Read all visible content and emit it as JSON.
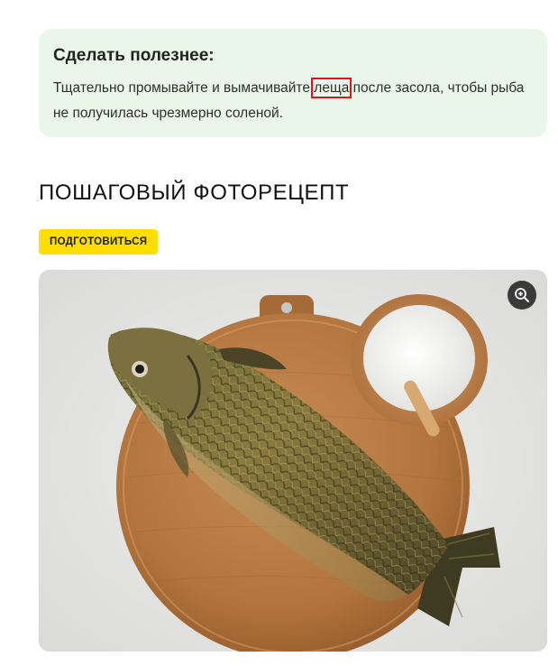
{
  "tip": {
    "title": "Сделать полезнее:",
    "text_before": "Тщательно промывайте и вымачивайте ",
    "highlighted_word": "леща",
    "text_after": " после засола, чтобы рыба не получилась чрезмерно соленой."
  },
  "section": {
    "title": "ПОШАГОВЫЙ ФОТОРЕЦЕПТ"
  },
  "prepare_button": {
    "label": "ПОДГОТОВИТЬСЯ"
  },
  "photo": {
    "zoom_icon": "zoom-in-icon"
  },
  "colors": {
    "tip_background": "#eaf6e9",
    "accent_yellow": "#ffde00",
    "highlight_red": "#e0141a"
  }
}
